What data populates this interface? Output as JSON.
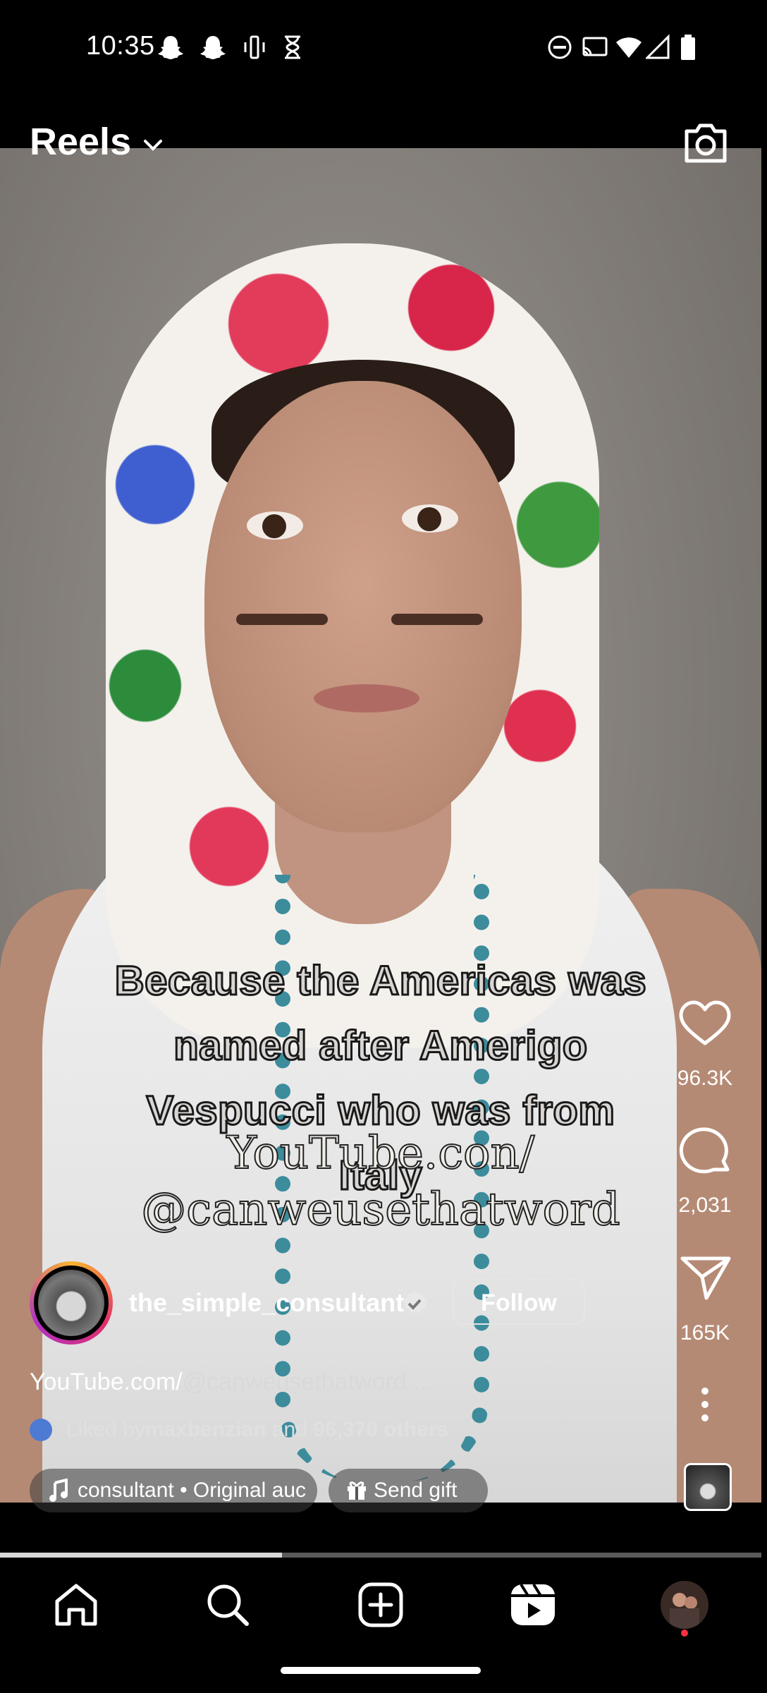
{
  "status_bar": {
    "time": "10:35",
    "left_icons": [
      "snapchat-icon",
      "snapchat-icon",
      "vibrate-icon",
      "hourglass-icon"
    ],
    "right_icons": [
      "do-not-disturb-icon",
      "cast-icon",
      "wifi-icon",
      "signal-icon",
      "battery-icon"
    ]
  },
  "header": {
    "title": "Reels",
    "dropdown_icon": "chevron-down-icon",
    "camera_icon": "camera-icon"
  },
  "video": {
    "caption_lines": [
      "Because the Americas was",
      "named after Amerigo",
      "Vespucci who was from",
      "Italy"
    ],
    "watermark_lines": [
      "YouTube.con/",
      "@canweusethatword"
    ]
  },
  "actions": {
    "like_count": "96.3K",
    "comment_count": "2,031",
    "share_count": "165K"
  },
  "author": {
    "username": "the_simple_consultant",
    "verified": true,
    "follow_label": "Follow"
  },
  "description": {
    "prefix": "YouTube.com/",
    "handle": "@canweusethatword ..."
  },
  "likes": {
    "prefix": "Liked by ",
    "user": "maxbenzian",
    "middle": " and ",
    "others": "96,370 others"
  },
  "audio": {
    "label": "consultant • Original auc"
  },
  "gift": {
    "label": "Send gift"
  },
  "playback": {
    "progress": 0.37
  },
  "bottom_nav": {
    "items": [
      "home-icon",
      "search-icon",
      "create-icon",
      "reels-icon",
      "profile-avatar"
    ],
    "active": "reels-icon"
  }
}
